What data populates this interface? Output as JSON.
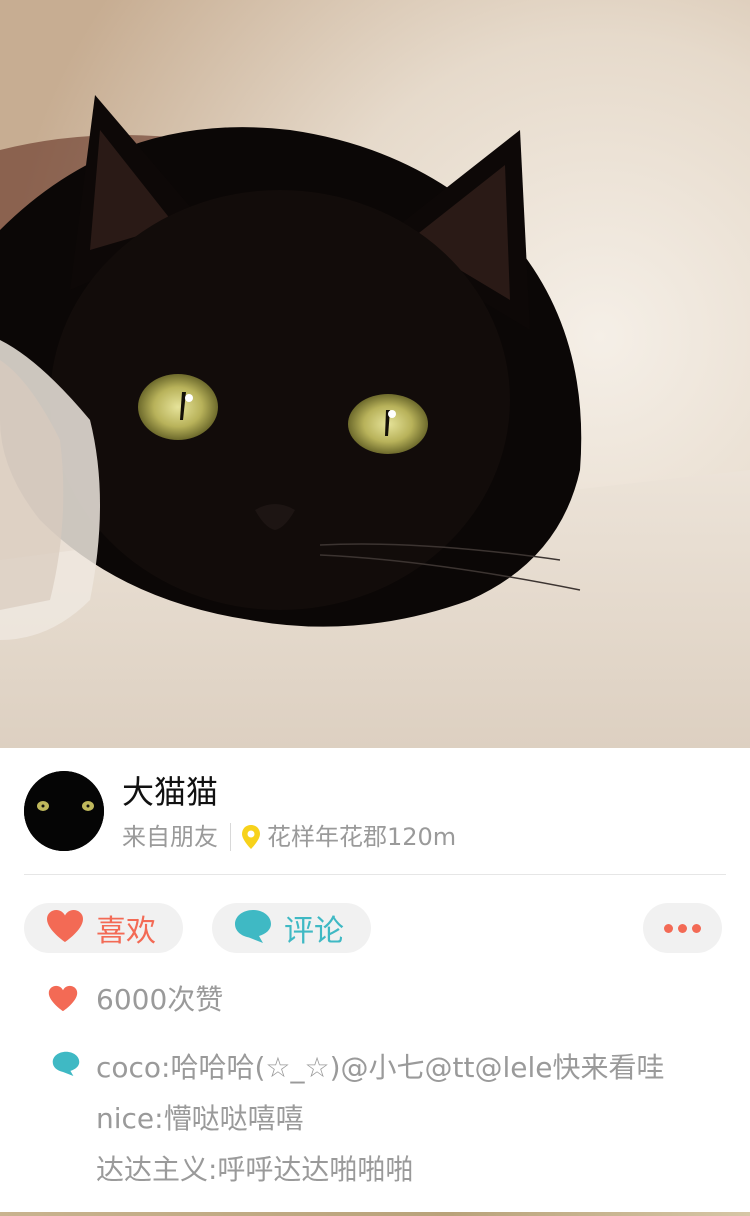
{
  "post": {
    "username": "大猫猫",
    "source": "来自朋友",
    "location": "花样年花郡120m"
  },
  "actions": {
    "like_label": "喜欢",
    "comment_label": "评论"
  },
  "likes": {
    "text": "6000次赞"
  },
  "comments": [
    {
      "text": "coco:哈哈哈(☆_☆)@小七@tt@lele快来看哇"
    },
    {
      "text": "nice:懵哒哒嘻嘻"
    },
    {
      "text": "达达主义:呼呼达达啪啪啪"
    }
  ],
  "colors": {
    "like_accent": "#f36a55",
    "comment_accent": "#3fb9c4",
    "location_pin": "#f7d21b"
  },
  "icons": {
    "like": "heart-icon",
    "comment": "speech-bubble-icon",
    "more": "more-dots-icon",
    "location": "location-pin-icon"
  }
}
